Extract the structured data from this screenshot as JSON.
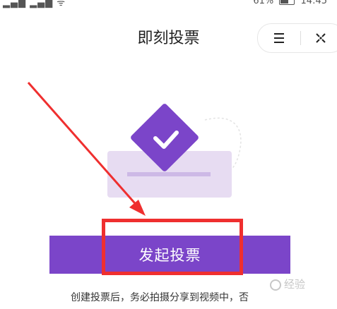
{
  "status_bar": {
    "left_glyphs": "▂▄▆  ▂▄▆  ᯤ",
    "battery_percent": "61%",
    "time": "14:45"
  },
  "header": {
    "title": "即刻投票"
  },
  "capsule": {
    "menu_icon": "menu-icon",
    "close_icon": "close-icon"
  },
  "main": {
    "start_vote_button_label": "发起投票",
    "description": "创建投票后，务必拍摄分享到视频中，否"
  },
  "watermark": {
    "text": "经验"
  },
  "colors": {
    "accent": "#7b45c9",
    "light_purple": "#e7dcf2",
    "annotation_red": "#ef2f2f"
  }
}
